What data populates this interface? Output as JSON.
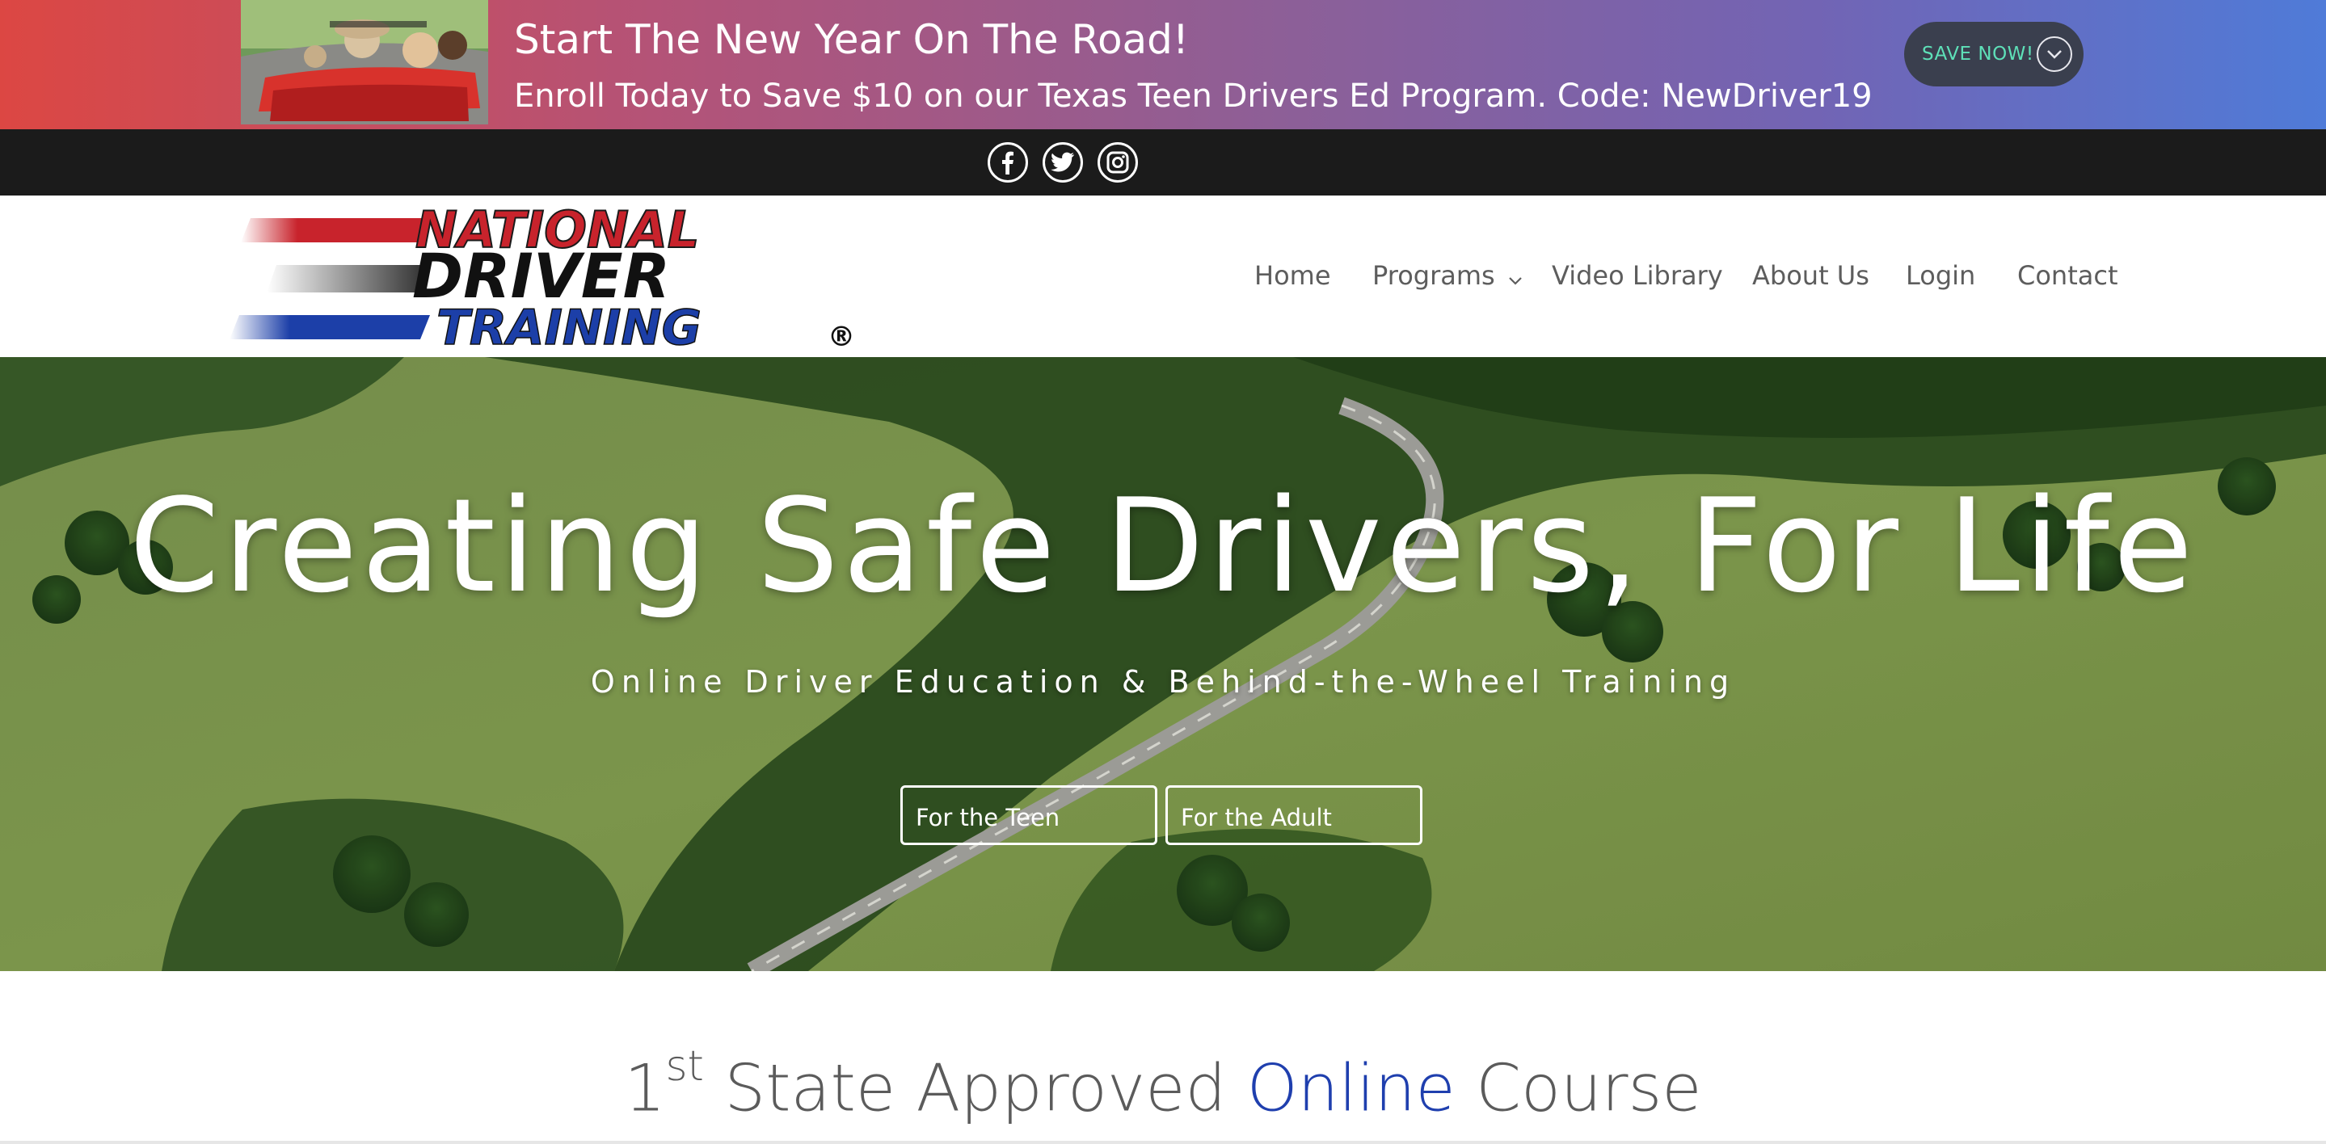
{
  "promo": {
    "title": "Start The New Year On The Road!",
    "subtitle": "Enroll Today to Save $10 on our Texas Teen Drivers Ed Program. Code: NewDriver19",
    "button_label": "SAVE NOW!"
  },
  "social": {
    "icons": [
      "facebook-icon",
      "twitter-icon",
      "instagram-icon"
    ]
  },
  "logo": {
    "line1": "NATIONAL",
    "line2": "DRIVER",
    "line3": "TRAINING",
    "mark": "®"
  },
  "nav": {
    "items": [
      {
        "label": "Home"
      },
      {
        "label": "Programs"
      },
      {
        "label": "Video Library"
      },
      {
        "label": "About Us"
      },
      {
        "label": "Login"
      },
      {
        "label": "Contact"
      }
    ]
  },
  "hero": {
    "title": "Creating Safe Drivers, For Life",
    "subtitle": "Online Driver Education & Behind-the-Wheel Training",
    "buttons": [
      {
        "label": "For the Teen"
      },
      {
        "label": "For the Adult"
      }
    ]
  },
  "section": {
    "heading_prefix": "1",
    "heading_sup": "st",
    "heading_mid": " State Approved ",
    "heading_accent": "Online",
    "heading_suffix": " Course"
  },
  "colors": {
    "accent_blue": "#1f3fae",
    "save_text": "#5ee0b8",
    "logo_red": "#c8232c",
    "logo_blue": "#1c3fa8"
  }
}
